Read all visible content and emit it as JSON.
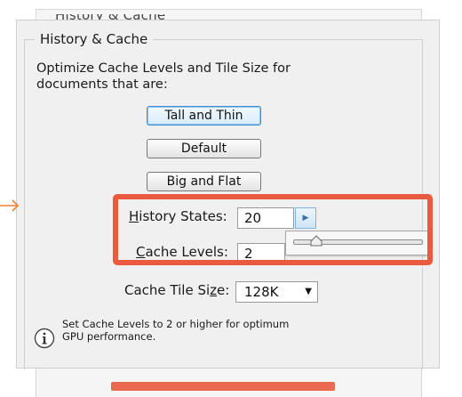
{
  "background_window": {
    "title": "History & Cache"
  },
  "group": {
    "legend": "History & Cache",
    "description": "Optimize Cache Levels and Tile Size for documents that are:"
  },
  "buttons": {
    "tall_and_thin": "Tall and Thin",
    "default": "Default",
    "big_and_flat": "Big and Flat"
  },
  "history_states": {
    "label_hotkey": "H",
    "label_rest": "istory States:",
    "value": "20",
    "slider_level": 0.15
  },
  "cache_levels": {
    "label_hotkey": "C",
    "label_rest": "ache Levels:",
    "value": "2"
  },
  "cache_tile_size": {
    "label_pre": "Cache Tile Si",
    "label_hotkey": "z",
    "label_post": "e:",
    "selected": "128K"
  },
  "info": {
    "icon": "info-icon",
    "text": "Set Cache Levels to 2 or higher for optimum GPU performance."
  },
  "annotations": {
    "highlight_color": "#ea5a3f",
    "arrow_color": "#f0822f"
  },
  "colors": {
    "focus_border": "#3c8fd4",
    "panel_bg": "#f0f0f0"
  }
}
